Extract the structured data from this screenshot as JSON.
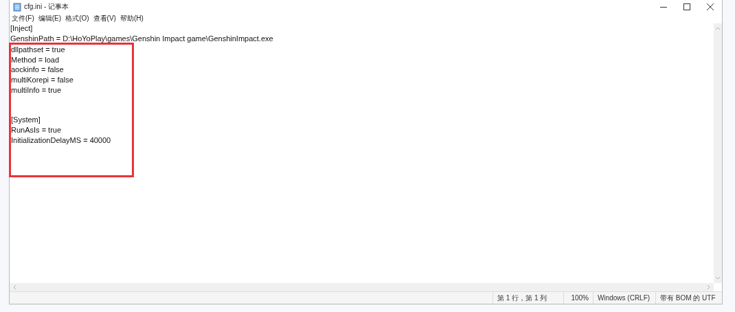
{
  "window": {
    "title": "cfg.ini - 记事本"
  },
  "menu": [
    "文件(F)",
    "编辑(E)",
    "格式(O)",
    "查看(V)",
    "帮助(H)"
  ],
  "editor": {
    "lines": [
      {
        "kind": "text",
        "text": "[Inject]"
      },
      {
        "kind": "text",
        "text": "GenshinPath = D:\\HoYoPlay\\games\\Genshin Impact game\\GenshinImpact.exe"
      }
    ],
    "marked_block": {
      "kind": "rectangle",
      "lines": [
        {
          "kind": "text",
          "text": "dllpathset = true"
        },
        {
          "kind": "text",
          "text": "Method = load"
        },
        {
          "kind": "text",
          "text": "aockinfo = false"
        },
        {
          "kind": "text",
          "text": "multiKorepi = false"
        },
        {
          "kind": "text",
          "text": "multiInfo = true"
        },
        {
          "kind": "blank"
        },
        {
          "kind": "blank"
        },
        {
          "kind": "text",
          "text": "[System]"
        },
        {
          "kind": "text",
          "text": "RunAsIs = true"
        },
        {
          "kind": "text",
          "text": "InitializationDelayMS = 40000"
        },
        {
          "kind": "blank"
        },
        {
          "kind": "blank"
        },
        {
          "kind": "blank"
        }
      ]
    }
  },
  "status_bar": {
    "position": "第 1 行，第 1 列",
    "zoom": "100%",
    "line_ending": "Windows (CRLF)",
    "encoding": "带有 BOM 的 UTF"
  }
}
